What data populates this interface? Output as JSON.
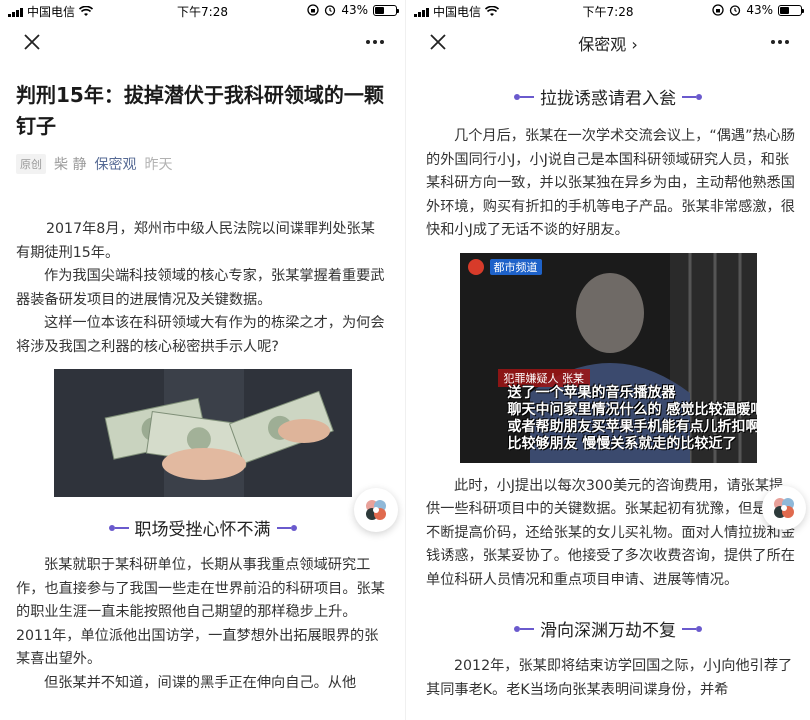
{
  "status": {
    "carrier": "中国电信",
    "time": "下午7:28",
    "battery": "43%",
    "battery_level": 0.43
  },
  "left": {
    "nav": {
      "close_icon": "close-icon",
      "more_icon": "more-icon"
    },
    "title": "判刑15年：拔掉潜伏于我科研领域的一颗钉子",
    "meta": {
      "tag": "原创",
      "author": "柴 静",
      "account": "保密观",
      "date": "昨天"
    },
    "paragraphs": [
      "2017年8月，郑州市中级人民法院以间谍罪判处张某有期徒刑15年。",
      "作为我国尖端科技领域的核心专家，张某掌握着重要武器装备研发项目的进展情况及关键数据。",
      "这样一位本该在科研领域大有作为的栋梁之才，为何会将涉及我国之利器的核心秘密拱手示人呢?"
    ],
    "section_title": "职场受挫心怀不满",
    "section_paragraphs": [
      "张某就职于某科研单位，长期从事我重点领域研究工作，也直接参与了我国一些走在世界前沿的科研项目。张某的职业生涯一直未能按照他自己期望的那样稳步上升。2011年，单位派他出国访学，一直梦想外出拓展眼界的张某喜出望外。",
      "但张某并不知道，间谍的黑手正在伸向自己。从他"
    ]
  },
  "right": {
    "nav": {
      "title": "保密观 ›",
      "close_icon": "close-icon",
      "more_icon": "more-icon"
    },
    "section1_title": "拉拢诱惑请君入瓮",
    "para1": "几个月后，张某在一次学术交流会议上，“偶遇”热心肠的外国同行小J，小J说自己是本国科研领域研究人员，和张某科研方向一致，并以张某独在异乡为由，主动帮他熟悉国外环境，购买有折扣的手机等电子产品。张某非常感激，很快和小J成了无话不谈的好朋友。",
    "video": {
      "logo_text": "都市频道",
      "caption_tag": "犯罪嫌疑人  张某",
      "subtitles": [
        "送了一个苹果的音乐播放器",
        "聊天中问家里情况什么的 感觉比较温暖吧",
        "或者帮助朋友买苹果手机能有点儿折扣啊",
        "比较够朋友 慢慢关系就走的比较近了"
      ]
    },
    "para2": "此时，小J提出以每次300美元的咨询费用，请张某提供一些科研项目中的关键数据。张某起初有犹豫，但是小J不断提高价码，还给张某的女儿买礼物。面对人情拉拢和金钱诱惑，张某妥协了。他接受了多次收费咨询，提供了所在单位科研人员情况和重点项目申请、进展等情况。",
    "section2_title": "滑向深渊万劫不复",
    "para3": "2012年，张某即将结束访学回国之际，小J向他引荐了其同事老K。老K当场向张某表明间谍身份，并希"
  }
}
